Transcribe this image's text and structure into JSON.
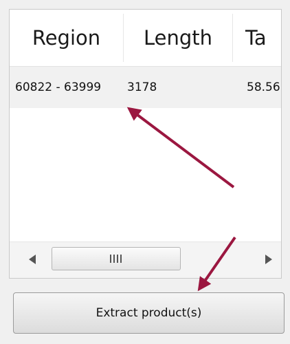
{
  "table": {
    "columns": [
      "Region",
      "Length",
      "Ta"
    ],
    "rows": [
      {
        "region": "60822 - 63999",
        "length": "3178",
        "ta": "58.56"
      }
    ]
  },
  "buttons": {
    "extract_label": "Extract product(s)"
  },
  "icons": {
    "scroll_left": "triangle-left-icon",
    "scroll_right": "triangle-right-icon",
    "scroll_grip": "grip-lines-icon",
    "annotation": "arrow-icon"
  },
  "colors": {
    "annotation_arrow": "#9b1740",
    "row_highlight": "#f1f1f1"
  }
}
